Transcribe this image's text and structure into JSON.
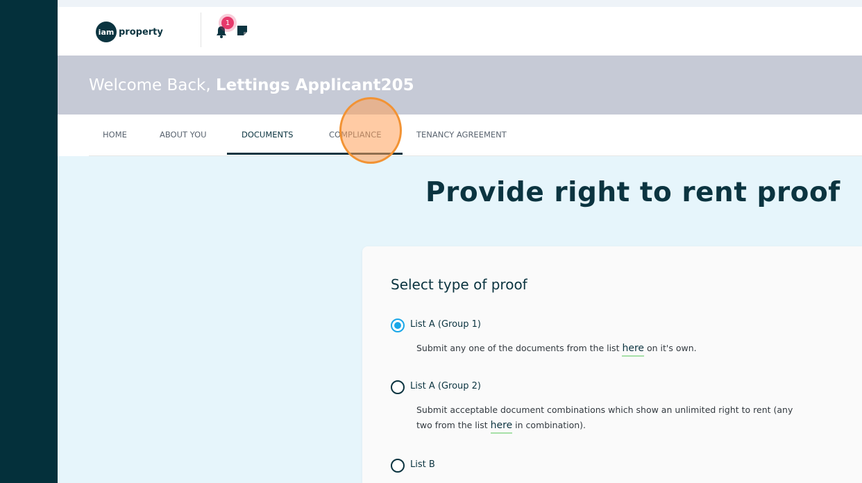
{
  "header": {
    "logo_iam": "iam",
    "logo_property": "property",
    "notification_count": "1"
  },
  "welcome": {
    "prefix": "Welcome Back, ",
    "user_name": "Lettings Applicant205"
  },
  "nav": {
    "tabs": [
      {
        "label": "HOME"
      },
      {
        "label": "ABOUT YOU"
      },
      {
        "label": "DOCUMENTS"
      },
      {
        "label": "COMPLIANCE"
      },
      {
        "label": "TENANCY AGREEMENT"
      }
    ],
    "active_tab": "DOCUMENTS"
  },
  "main": {
    "title": "Provide right to rent proof",
    "card_title": "Select type of proof",
    "options": [
      {
        "label": "List A (Group 1)",
        "checked": true,
        "desc_before": "Submit any one of the documents from the list ",
        "link": "here",
        "desc_after": " on it's own."
      },
      {
        "label": "List A (Group 2)",
        "checked": false,
        "desc_line1": "Submit acceptable document combinations which show an unlimited right to rent (any",
        "desc_line2_before": "two from the list ",
        "link": "here",
        "desc_line2_after": " in combination)."
      },
      {
        "label": "List B",
        "checked": false
      }
    ]
  },
  "colors": {
    "sidebar": "#04303b",
    "brand_dark": "#0b3440",
    "radio_selected": "#1aa7e8",
    "badge": "#e6396b"
  }
}
